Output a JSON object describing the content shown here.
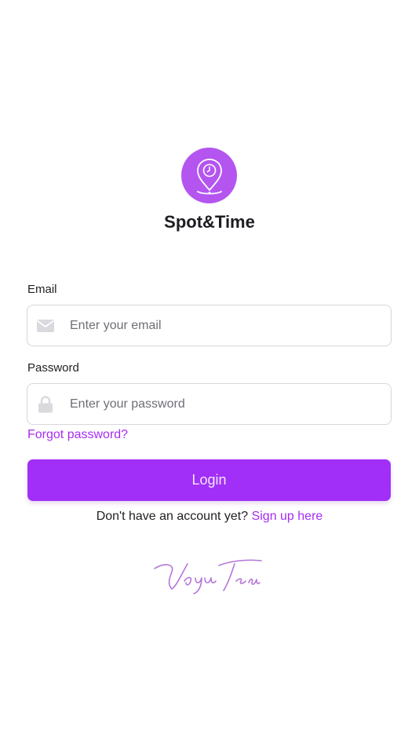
{
  "brand": {
    "name": "Spot&Time",
    "accent_color": "#a22ff7",
    "logo_icon": "location-clock-icon"
  },
  "form": {
    "email": {
      "label": "Email",
      "placeholder": "Enter your email",
      "icon": "envelope-icon"
    },
    "password": {
      "label": "Password",
      "placeholder": "Enter your password",
      "icon": "lock-icon"
    },
    "forgot_password": "Forgot password?",
    "login_label": "Login"
  },
  "signup": {
    "prompt": "Don't have an account yet?",
    "link": "Sign up here"
  },
  "footer": {
    "signature_icon": "signature-logo"
  }
}
